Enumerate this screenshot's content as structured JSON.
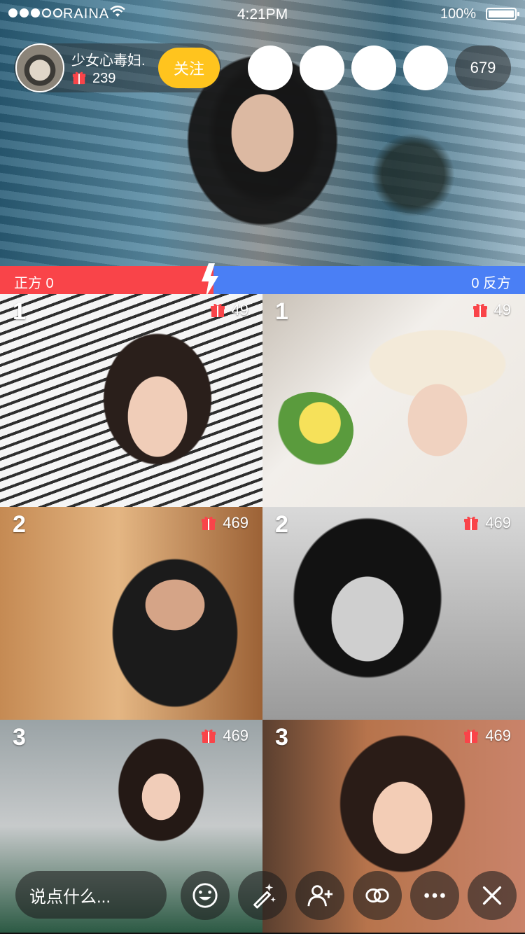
{
  "status_bar": {
    "carrier": "RAINA",
    "signal_dots_filled": 3,
    "signal_dots_total": 5,
    "time": "4:21PM",
    "battery_percent": "100%"
  },
  "host": {
    "name": "少女心毒妇.",
    "gift_count": "239",
    "follow_label": "关注"
  },
  "viewers": {
    "count": "679"
  },
  "versus": {
    "left_label": "正方 0",
    "right_label": "0 反方",
    "left_color": "#f94449",
    "right_color": "#4a7ff5"
  },
  "tiles": [
    {
      "rank": "1",
      "gifts": "49"
    },
    {
      "rank": "1",
      "gifts": "49"
    },
    {
      "rank": "2",
      "gifts": "469"
    },
    {
      "rank": "2",
      "gifts": "469"
    },
    {
      "rank": "3",
      "gifts": "469"
    },
    {
      "rank": "3",
      "gifts": "469"
    }
  ],
  "bottom_bar": {
    "comment_placeholder": "说点什么...",
    "actions": [
      "emoji-icon",
      "magic-wand-icon",
      "add-user-icon",
      "link-icon",
      "more-icon",
      "close-icon"
    ]
  },
  "colors": {
    "follow_button": "#ffc41e",
    "gift_icon": "#f94449"
  }
}
